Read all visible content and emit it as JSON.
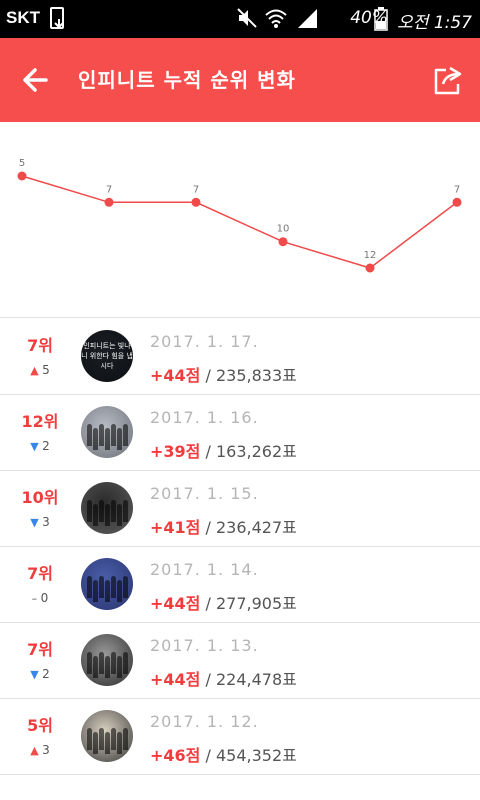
{
  "status_bar": {
    "carrier": "SKT",
    "battery_percent": "40%",
    "time": "오전 1:57",
    "icons": [
      "download-icon",
      "mute-icon",
      "wifi-icon",
      "signal-icon",
      "battery-icon"
    ]
  },
  "app_bar": {
    "title": "인피니트 누적 순위 변화",
    "back_icon": "back-arrow-icon",
    "share_icon": "share-icon",
    "color": "#f64d4d"
  },
  "chart_data": {
    "type": "line",
    "x": [
      "2017. 1. 12.",
      "2017. 1. 13.",
      "2017. 1. 14.",
      "2017. 1. 15.",
      "2017. 1. 16.",
      "2017. 1. 17."
    ],
    "values": [
      5,
      7,
      7,
      10,
      12,
      7
    ],
    "labels": [
      "5",
      "7",
      "7",
      "10",
      "12",
      "7"
    ],
    "y_inverted": true,
    "ylim": [
      5,
      12
    ],
    "grid": false,
    "color": "#f04a4a"
  },
  "rows": [
    {
      "rank": "7위",
      "change_dir": "up",
      "change": "5",
      "date": "2017. 1. 17.",
      "score": "+44점",
      "votes": "235,833표"
    },
    {
      "rank": "12위",
      "change_dir": "down",
      "change": "2",
      "date": "2017. 1. 16.",
      "score": "+39점",
      "votes": "163,262표"
    },
    {
      "rank": "10위",
      "change_dir": "down",
      "change": "3",
      "date": "2017. 1. 15.",
      "score": "+41점",
      "votes": "236,427표"
    },
    {
      "rank": "7위",
      "change_dir": "same",
      "change": "0",
      "date": "2017. 1. 14.",
      "score": "+44점",
      "votes": "277,905표"
    },
    {
      "rank": "7위",
      "change_dir": "down",
      "change": "2",
      "date": "2017. 1. 13.",
      "score": "+44점",
      "votes": "224,478표"
    },
    {
      "rank": "5위",
      "change_dir": "up",
      "change": "3",
      "date": "2017. 1. 12.",
      "score": "+46점",
      "votes": "454,352표"
    }
  ],
  "avatar_text": "인피니트는 빛나니 위한다 힘을 냅시다"
}
